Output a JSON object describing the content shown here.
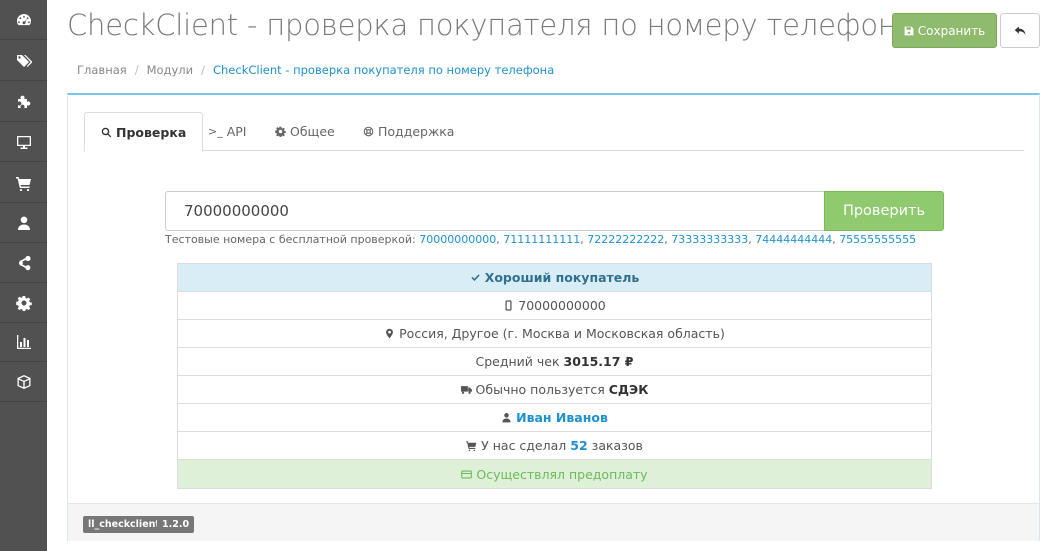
{
  "sidebar": {
    "items": [
      {
        "icon": "dashboard-icon"
      },
      {
        "icon": "tags-icon"
      },
      {
        "icon": "puzzle-icon"
      },
      {
        "icon": "monitor-icon"
      },
      {
        "icon": "cart-icon"
      },
      {
        "icon": "user-icon"
      },
      {
        "icon": "share-icon"
      },
      {
        "icon": "gear-icon"
      },
      {
        "icon": "bar-chart-icon"
      },
      {
        "icon": "cube-icon"
      }
    ]
  },
  "header": {
    "title": "CheckClient - проверка покупателя по номеру телефона",
    "save_label": "Сохранить"
  },
  "breadcrumb": {
    "items": [
      "Главная",
      "Модули",
      "CheckClient - проверка покупателя по номеру телефона"
    ]
  },
  "tabs": [
    {
      "label": "Проверка",
      "icon": "search-icon",
      "active": true
    },
    {
      "label": "API",
      "icon": "terminal-icon",
      "active": false
    },
    {
      "label": "Общее",
      "icon": "gear-icon",
      "active": false
    },
    {
      "label": "Поддержка",
      "icon": "life-ring-icon",
      "active": false
    }
  ],
  "form": {
    "phone_value": "70000000000",
    "check_label": "Проверить",
    "hint_prefix": "Тестовые номера с бесплатной проверкой:",
    "test_numbers": [
      "70000000000",
      "71111111111",
      "72222222222",
      "73333333333",
      "74444444444",
      "75555555555"
    ]
  },
  "result": {
    "status": "Хороший покупатель",
    "phone": "70000000000",
    "location": "Россия, Другое (г. Москва и Московская область)",
    "avg_check_label": "Средний чек",
    "avg_check_value": "3015.17 ₽",
    "delivery_label": "Обычно пользуется",
    "delivery_value": "СДЭК",
    "name": "Иван Иванов",
    "orders_prefix": "У нас сделал",
    "orders_count": "52",
    "orders_suffix": "заказов",
    "prepay": "Осуществлял предоплату"
  },
  "footer": {
    "module_code": "ll_checkclient",
    "version": "1.2.0"
  },
  "colors": {
    "sidebar_bg": "#515151",
    "save_green": "#8fbb6c",
    "check_green": "#8fca6e",
    "link_blue": "#1e91cf",
    "info_bg": "#d9edf7",
    "success_bg": "#dff0d8"
  }
}
